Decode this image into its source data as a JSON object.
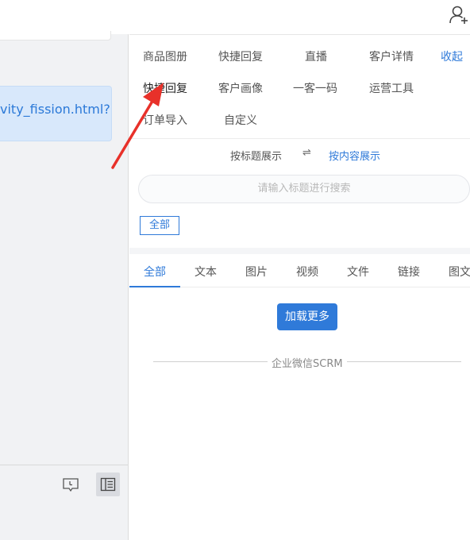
{
  "chat": {
    "message_text": "vity_fission.html?"
  },
  "panel": {
    "collapse_label": "收起",
    "tools": [
      {
        "label": "商品图册"
      },
      {
        "label": "快捷回复"
      },
      {
        "label": "直播"
      },
      {
        "label": "客户详情"
      },
      {
        "label": "快捷回复"
      },
      {
        "label": "客户画像"
      },
      {
        "label": "一客一码"
      },
      {
        "label": "运营工具"
      },
      {
        "label": "订单导入"
      },
      {
        "label": "自定义"
      }
    ],
    "display_mode": {
      "by_title": "按标题展示",
      "swap_symbol": "⇌",
      "by_content": "按内容展示"
    },
    "search": {
      "placeholder": "请输入标题进行搜索"
    },
    "filter_tag": "全部",
    "tabs": [
      {
        "label": "全部"
      },
      {
        "label": "文本"
      },
      {
        "label": "图片"
      },
      {
        "label": "视频"
      },
      {
        "label": "文件"
      },
      {
        "label": "链接"
      },
      {
        "label": "图文"
      }
    ],
    "load_more": "加载更多",
    "footer": "企业微信SCRM"
  },
  "colors": {
    "accent": "#2f7ad9",
    "annotation_arrow": "#e8312a"
  },
  "icons": {
    "top_right": "add-user-icon",
    "chat_footer": [
      "chat-history-icon",
      "side-panel-icon"
    ]
  }
}
